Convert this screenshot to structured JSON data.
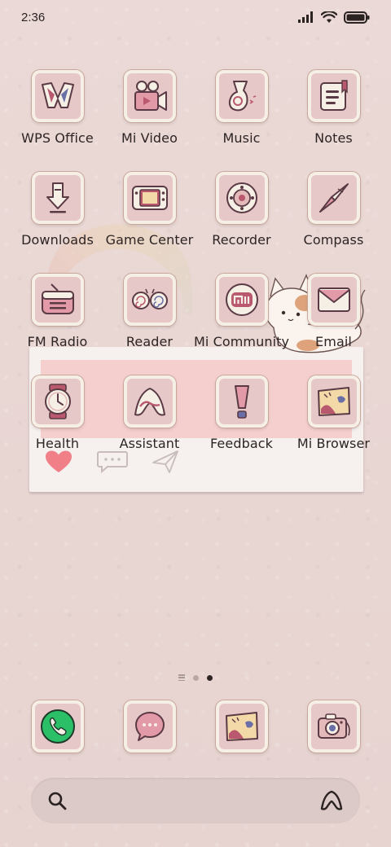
{
  "status_bar": {
    "time": "2:36"
  },
  "apps": [
    {
      "label": "WPS Office",
      "icon": "wps-office-icon"
    },
    {
      "label": "Mi Video",
      "icon": "mi-video-icon"
    },
    {
      "label": "Music",
      "icon": "music-icon"
    },
    {
      "label": "Notes",
      "icon": "notes-icon"
    },
    {
      "label": "Downloads",
      "icon": "downloads-icon"
    },
    {
      "label": "Game Center",
      "icon": "game-center-icon"
    },
    {
      "label": "Recorder",
      "icon": "recorder-icon"
    },
    {
      "label": "Compass",
      "icon": "compass-icon"
    },
    {
      "label": "FM Radio",
      "icon": "fm-radio-icon"
    },
    {
      "label": "Reader",
      "icon": "reader-icon"
    },
    {
      "label": "Mi Community",
      "icon": "mi-community-icon"
    },
    {
      "label": "Email",
      "icon": "email-icon"
    },
    {
      "label": "Health",
      "icon": "health-icon"
    },
    {
      "label": "Assistant",
      "icon": "assistant-icon"
    },
    {
      "label": "Feedback",
      "icon": "feedback-icon"
    },
    {
      "label": "Mi Browser",
      "icon": "mi-browser-icon"
    }
  ],
  "dock": [
    {
      "icon": "phone-icon"
    },
    {
      "icon": "messages-icon"
    },
    {
      "icon": "gallery-icon"
    },
    {
      "icon": "camera-icon"
    }
  ],
  "page_indicator": {
    "pages": 2,
    "active_index": 1
  },
  "search": {
    "placeholder": ""
  },
  "colors": {
    "background": "#ead9d6",
    "tile": "#e7c8c9",
    "tile_border": "#f6efe6",
    "accent": "#b9586e"
  }
}
